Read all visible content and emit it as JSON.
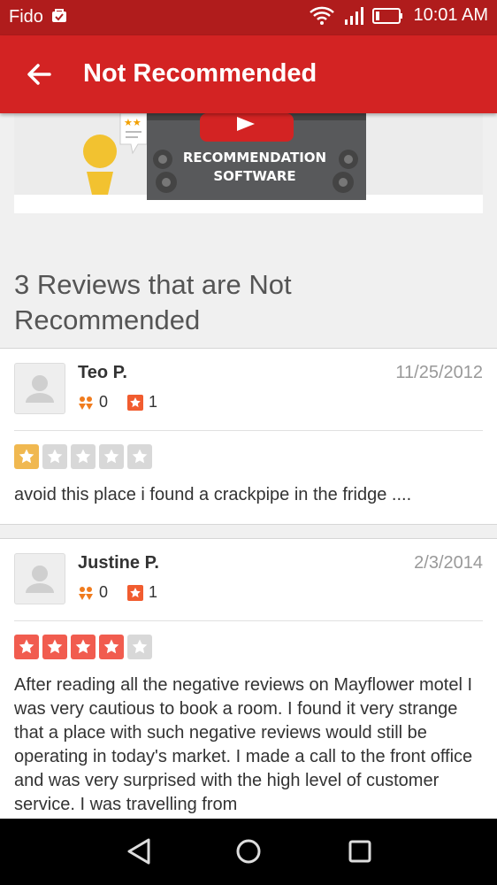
{
  "status_bar": {
    "carrier": "Fido",
    "time": "10:01 AM"
  },
  "app_bar": {
    "title": "Not Recommended"
  },
  "banner": {
    "line1": "RECOMMENDATION",
    "line2": "SOFTWARE"
  },
  "section_title": "3 Reviews that are Not Recommended",
  "reviews": [
    {
      "name": "Teo P.",
      "date": "11/25/2012",
      "friends": "0",
      "reviews_count": "1",
      "rating": 1,
      "text": "avoid this place i found a crackpipe in the fridge ...."
    },
    {
      "name": "Justine P.",
      "date": "2/3/2014",
      "friends": "0",
      "reviews_count": "1",
      "rating": 4,
      "text": "After reading all the negative reviews on  Mayflower motel I was very cautious to book a room.   I found it very strange that a place with such negative reviews would still be operating in today's market. I made a call to the front office  and was very surprised with the high level of customer service. I was travelling from"
    }
  ],
  "colors": {
    "brand_red": "#d32323",
    "status_red": "#b01c1c",
    "star_one": "#f0b850",
    "star_four": "#f15c4f",
    "star_empty": "#d8d8d8"
  }
}
